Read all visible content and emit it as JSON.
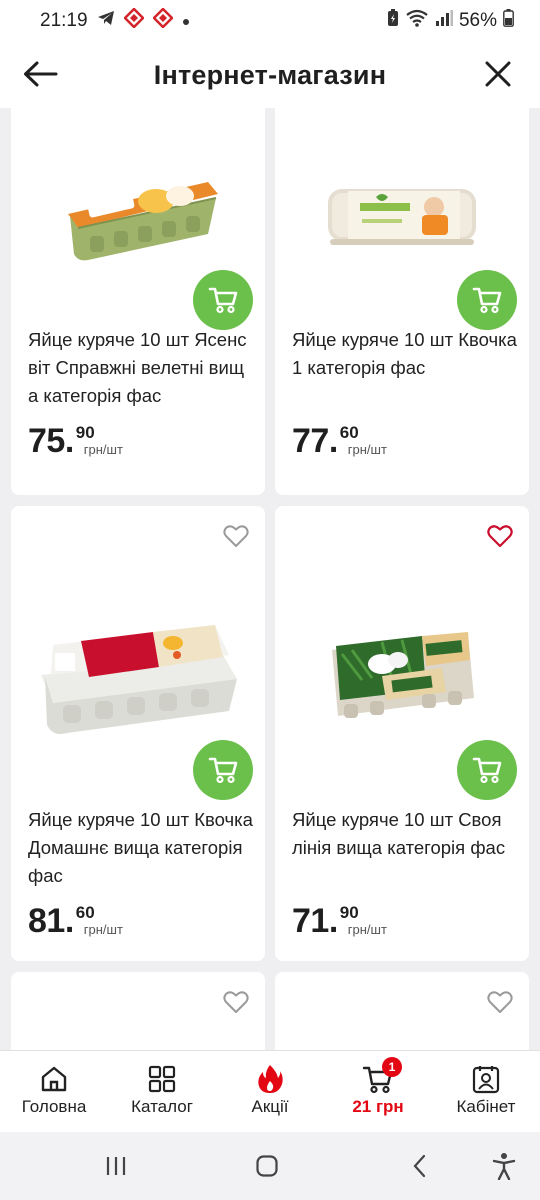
{
  "status_bar": {
    "time": "21:19",
    "battery": "56%"
  },
  "app_bar": {
    "title": "Інтернет-магазин",
    "back_icon": "arrow-left-icon",
    "close_icon": "close-icon"
  },
  "products": [
    {
      "name": "Яйце куряче 10 шт Ясенсвіт Справжні велетні вища категорія фас",
      "price_whole": "75.",
      "price_cents": "90",
      "unit": "грн/шт",
      "favorite": false
    },
    {
      "name": "Яйце куряче 10 шт Квочка 1 категорія фас",
      "price_whole": "77.",
      "price_cents": "60",
      "unit": "грн/шт",
      "favorite": false
    },
    {
      "name": "Яйце куряче 10 шт Квочка Домашнє вища категорія фас",
      "price_whole": "81.",
      "price_cents": "60",
      "unit": "грн/шт",
      "favorite": false
    },
    {
      "name": "Яйце куряче 10 шт Своя лінія вища категорія фас",
      "price_whole": "71.",
      "price_cents": "90",
      "unit": "грн/шт",
      "favorite": true
    }
  ],
  "bottom_nav": {
    "items": [
      {
        "label": "Головна",
        "icon": "home-icon"
      },
      {
        "label": "Каталог",
        "icon": "grid-icon"
      },
      {
        "label": "Акції",
        "icon": "flame-icon"
      },
      {
        "label": "21 грн",
        "icon": "cart-icon",
        "badge": "1"
      },
      {
        "label": "Кабінет",
        "icon": "profile-icon"
      }
    ]
  },
  "colors": {
    "accent_red": "#e30613",
    "cart_green": "#6bc04b",
    "favorite_red": "#c8102e"
  }
}
